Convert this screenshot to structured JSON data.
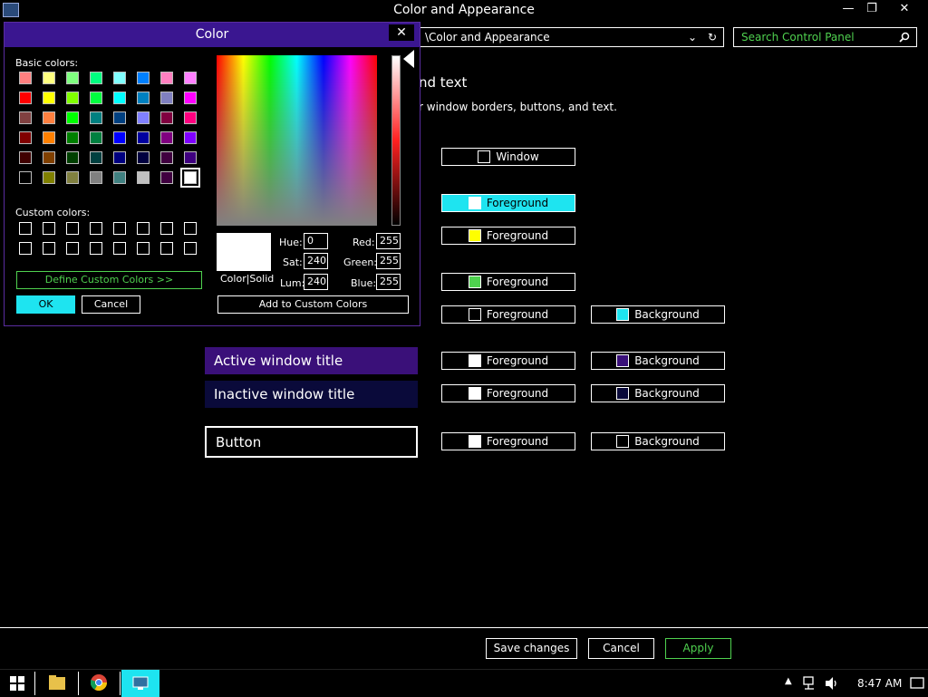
{
  "window": {
    "title": "Color and Appearance",
    "minimize": "—",
    "restore": "❐",
    "close": "✕"
  },
  "address": {
    "path": "\\Color and Appearance",
    "dropdown": "⌄",
    "refresh": "↻"
  },
  "search": {
    "placeholder": "Search Control Panel"
  },
  "intro": {
    "heading": "nd text",
    "description": "r window borders, buttons, and text."
  },
  "items": {
    "window_label": "Window",
    "highlight_fg": "Foreground",
    "yellow_fg": "Foreground",
    "green_fg": "Foreground",
    "row5_fg": "Foreground",
    "row5_bg": "Background",
    "active_title": "Active window title",
    "active_fg": "Foreground",
    "active_bg": "Background",
    "inactive_title": "Inactive window title",
    "inactive_fg": "Foreground",
    "inactive_bg": "Background",
    "button_label": "Button",
    "button_fg": "Foreground",
    "button_bg": "Background"
  },
  "footer": {
    "save": "Save changes",
    "cancel": "Cancel",
    "apply": "Apply"
  },
  "taskbar": {
    "time": "8:47 AM"
  },
  "dialog": {
    "title": "Color",
    "close": "✕",
    "basic_label": "Basic colors:",
    "custom_label": "Custom colors:",
    "define_custom": "Define Custom Colors >>",
    "ok": "OK",
    "cancel": "Cancel",
    "color_solid": "Color|Solid",
    "hue_label": "Hue:",
    "hue": "0",
    "sat_label": "Sat:",
    "sat": "240",
    "lum_label": "Lum:",
    "lum": "240",
    "red_label": "Red:",
    "red": "255",
    "green_label": "Green:",
    "green": "255",
    "blue_label": "Blue:",
    "blue": "255",
    "add_custom": "Add to Custom Colors",
    "basic_colors": [
      "#ff8080",
      "#ffff80",
      "#80ff80",
      "#00ff80",
      "#80ffff",
      "#0080ff",
      "#ff80c0",
      "#ff80ff",
      "#ff0000",
      "#ffff00",
      "#80ff00",
      "#00ff40",
      "#00ffff",
      "#0080c0",
      "#8080c0",
      "#ff00ff",
      "#804040",
      "#ff8040",
      "#00ff00",
      "#008080",
      "#004080",
      "#8080ff",
      "#800040",
      "#ff0080",
      "#800000",
      "#ff8000",
      "#008000",
      "#008040",
      "#0000ff",
      "#0000a0",
      "#800080",
      "#8000ff",
      "#400000",
      "#804000",
      "#004000",
      "#004040",
      "#000080",
      "#000040",
      "#400040",
      "#400080",
      "#000000",
      "#808000",
      "#808040",
      "#808080",
      "#408080",
      "#c0c0c0",
      "#400040",
      "#ffffff"
    ]
  },
  "colors": {
    "highlight": "#1ee4f0",
    "active_title_bg": "#3a1079",
    "inactive_title_bg": "#0a0a3a",
    "accent_green": "#4fd14f"
  }
}
